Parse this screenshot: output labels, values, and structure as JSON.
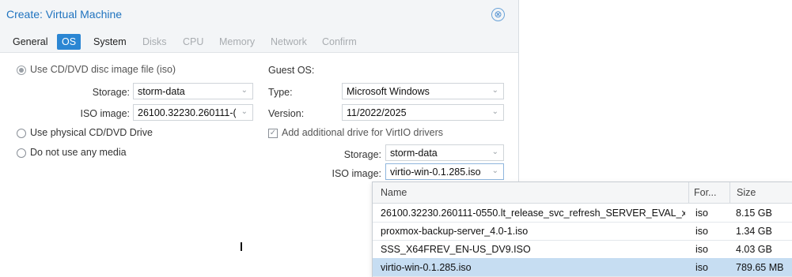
{
  "dialog": {
    "title": "Create: Virtual Machine",
    "close_icon": "⊗"
  },
  "tabs": [
    {
      "label": "General",
      "state": "normal"
    },
    {
      "label": "OS",
      "state": "active"
    },
    {
      "label": "System",
      "state": "normal"
    },
    {
      "label": "Disks",
      "state": "disabled"
    },
    {
      "label": "CPU",
      "state": "disabled"
    },
    {
      "label": "Memory",
      "state": "disabled"
    },
    {
      "label": "Network",
      "state": "disabled"
    },
    {
      "label": "Confirm",
      "state": "disabled"
    }
  ],
  "media": {
    "iso_option": "Use CD/DVD disc image file (iso)",
    "storage_label": "Storage:",
    "storage_value": "storm-data",
    "iso_label": "ISO image:",
    "iso_value": "26100.32230.260111-(",
    "physical_option": "Use physical CD/DVD Drive",
    "none_option": "Do not use any media"
  },
  "guest_os": {
    "heading": "Guest OS:",
    "type_label": "Type:",
    "type_value": "Microsoft Windows",
    "version_label": "Version:",
    "version_value": "11/2022/2025",
    "virtio_checkbox": "Add additional drive for VirtIO drivers",
    "virtio_storage_label": "Storage:",
    "virtio_storage_value": "storm-data",
    "virtio_iso_label": "ISO image:",
    "virtio_iso_value": "virtio-win-0.1.285.iso"
  },
  "iso_list": {
    "columns": {
      "name": "Name",
      "format": "For...",
      "size": "Size"
    },
    "rows": [
      {
        "name": "26100.32230.260111-0550.lt_release_svc_refresh_SERVER_EVAL_x...",
        "format": "iso",
        "size": "8.15 GB"
      },
      {
        "name": "proxmox-backup-server_4.0-1.iso",
        "format": "iso",
        "size": "1.34 GB"
      },
      {
        "name": "SSS_X64FREV_EN-US_DV9.ISO",
        "format": "iso",
        "size": "4.03 GB"
      },
      {
        "name": "virtio-win-0.1.285.iso",
        "format": "iso",
        "size": "789.65 MB"
      }
    ],
    "selected_index": 3
  },
  "icons": {
    "chevron": "chevron-down-icon",
    "close": "close-icon"
  },
  "colors": {
    "accent": "#2b86d3",
    "title": "#1f73bf",
    "selected_row": "#c6ddf2"
  }
}
